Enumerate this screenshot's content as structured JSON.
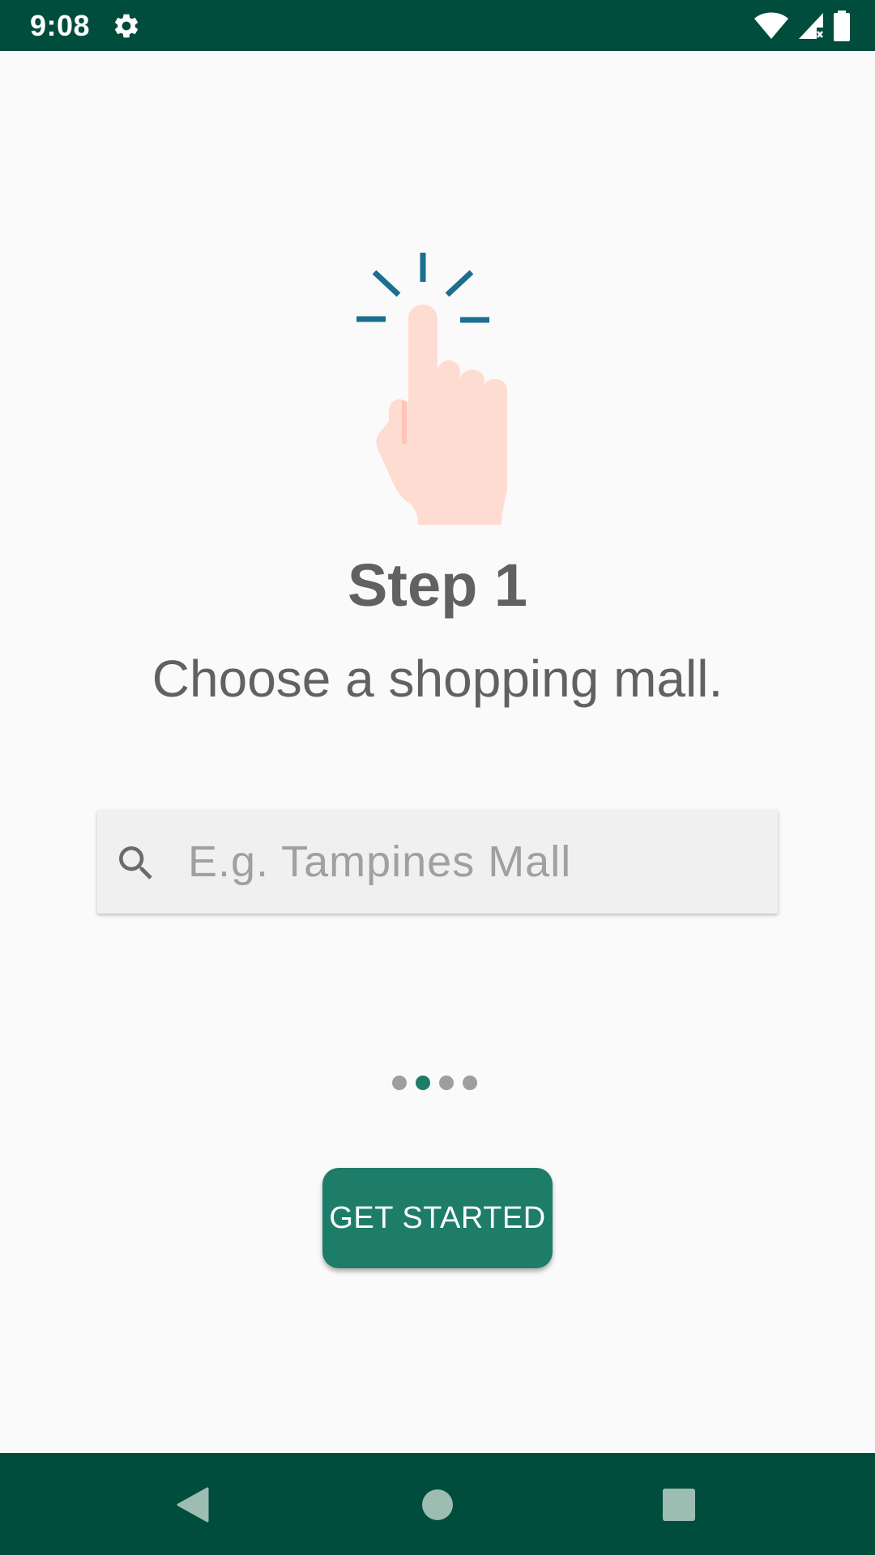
{
  "status_bar": {
    "time": "9:08",
    "icons": [
      "settings-icon",
      "wifi-icon",
      "cellular-signal-icon",
      "battery-icon"
    ]
  },
  "onboarding": {
    "illustration": "tap-finger-icon",
    "title": "Step 1",
    "description": "Choose a shopping mall.",
    "search": {
      "placeholder": "E.g. Tampines Mall",
      "value": ""
    },
    "page_indicator": {
      "total": 4,
      "active_index": 1
    },
    "primary_button": "GET STARTED"
  },
  "navigation_bar": {
    "icons": [
      "back-icon",
      "home-icon",
      "recents-icon"
    ]
  },
  "colors": {
    "status_bar": "#004d3d",
    "accent": "#1e7d69",
    "text": "#616161",
    "background": "#fafafa",
    "illustration_lines": "#1b6f8f",
    "skin": "#ffdcd2"
  }
}
